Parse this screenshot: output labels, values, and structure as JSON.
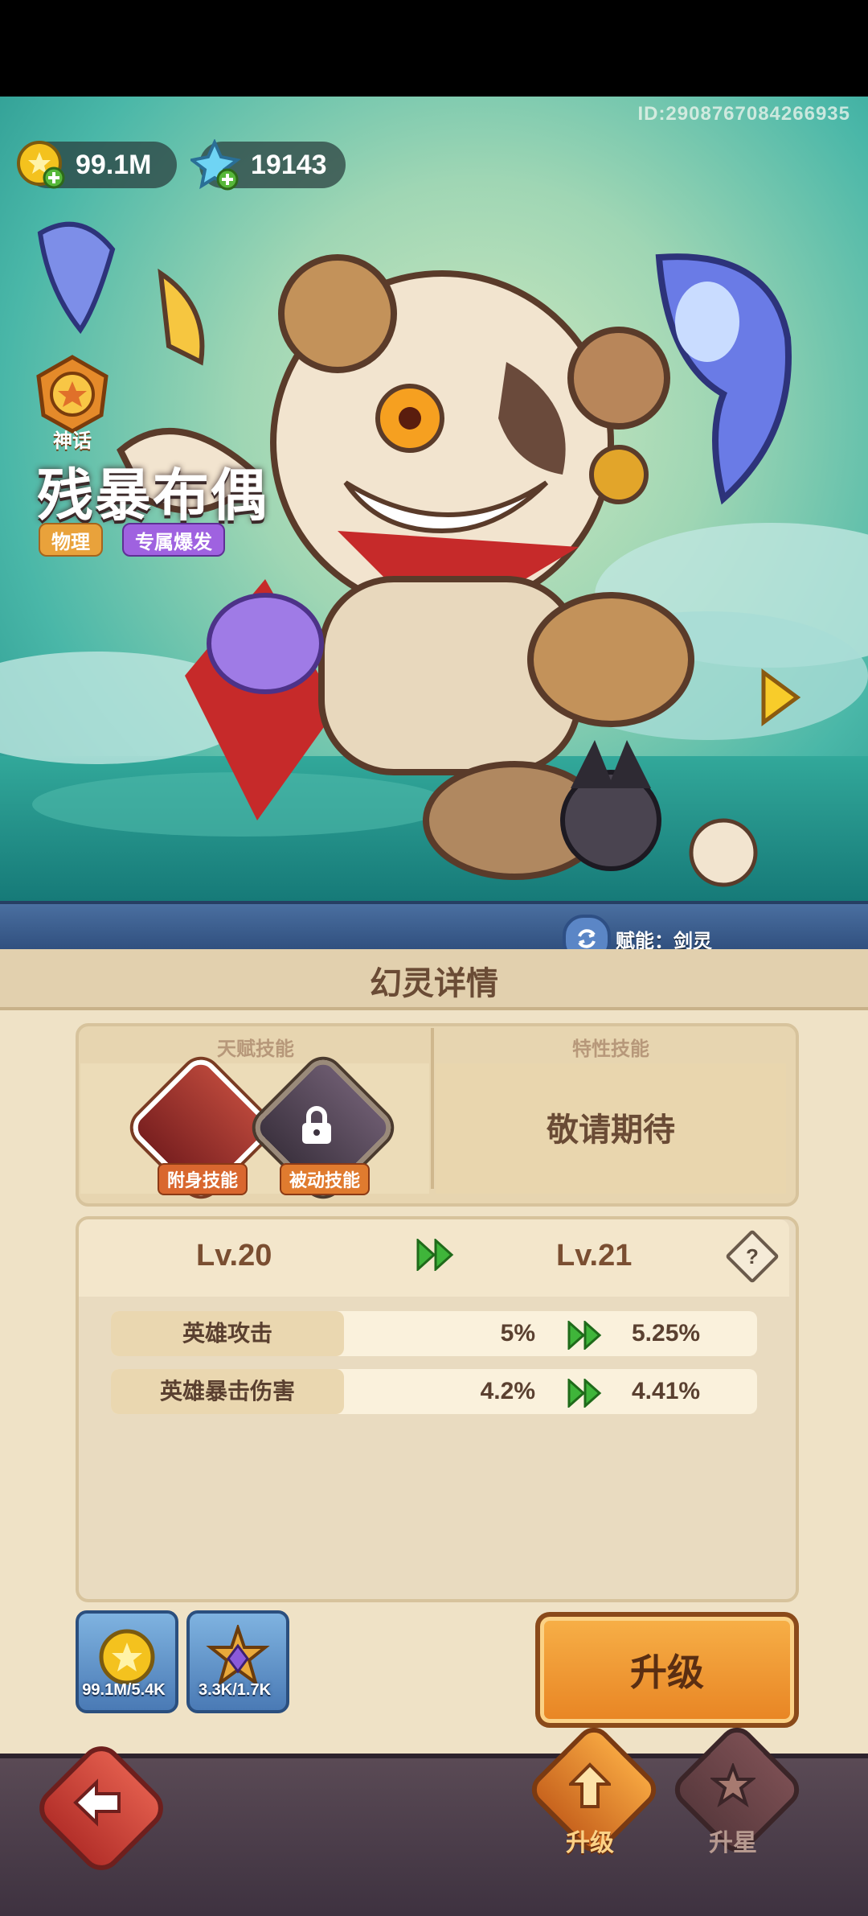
{
  "header": {
    "player_id": "ID:2908767084266935",
    "gold": "99.1M",
    "crystal": "19143"
  },
  "hero": {
    "rank": "神话",
    "name": "残暴布偶",
    "tag_type": "物理",
    "tag_exclusive": "专属爆发",
    "fuse_text": "赋能：剑灵"
  },
  "panel": {
    "title": "幻灵详情",
    "talent_header": "天赋技能",
    "trait_header": "特性技能",
    "skill1_label": "附身技能",
    "skill2_label": "被动技能",
    "trait_placeholder": "敬请期待",
    "level_from": "Lv.20",
    "level_to": "Lv.21",
    "help": "?",
    "stats": [
      {
        "label": "英雄攻击",
        "from": "5%",
        "to": "5.25%"
      },
      {
        "label": "英雄暴击伤害",
        "from": "4.2%",
        "to": "4.41%"
      }
    ],
    "cost_gold": "99.1M/5.4K",
    "cost_shard": "3.3K/1.7K",
    "upgrade_button": "升级"
  },
  "nav": {
    "upgrade": "升级",
    "star": "升星"
  },
  "colors": {
    "accent": "#e88423",
    "green_arrow": "#3fb53a"
  }
}
